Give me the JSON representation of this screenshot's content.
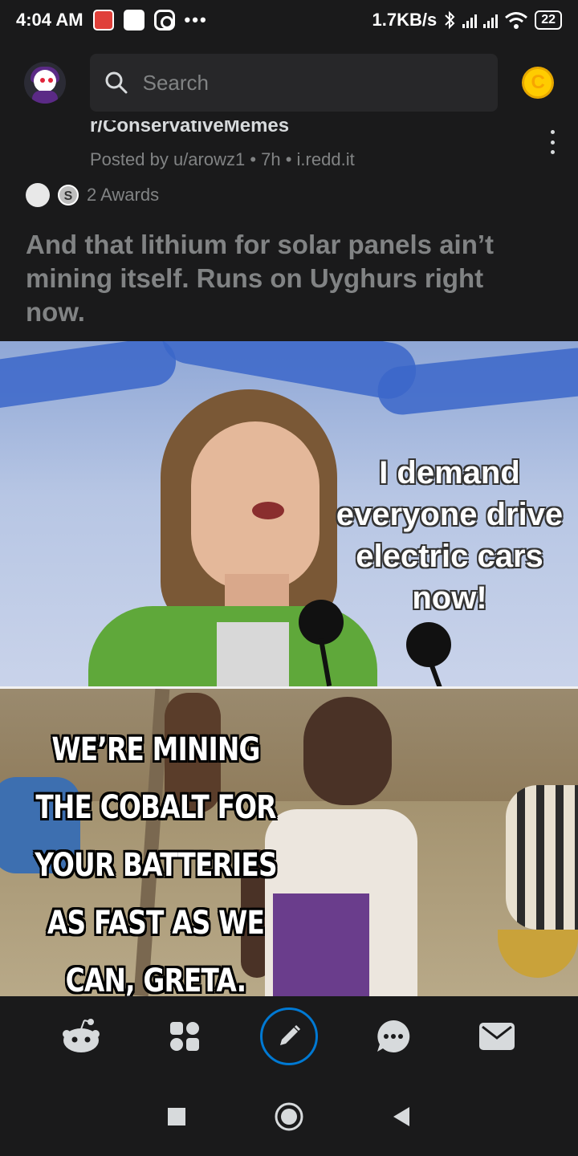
{
  "status_bar": {
    "time": "4:04 AM",
    "dots": "•••",
    "net_speed": "1.7KB/s",
    "battery": "22"
  },
  "search": {
    "placeholder": "Search"
  },
  "post": {
    "subreddit": "r/ConservativeMemes",
    "byline": "Posted by u/arowz1 • 7h • i.redd.it",
    "awards_label": "2 Awards",
    "title": "And that lithium for solar panels ain’t mining itself. Runs on Uyghurs right now.",
    "meme_top_text": "I demand everyone drive electric cars now!",
    "meme_bottom_lines": [
      "WE’RE MINING",
      "THE COBALT FOR",
      "YOUR BATTERIES",
      "AS FAST AS WE",
      "CAN, GRETA."
    ]
  },
  "icons": {
    "status": [
      "app-notification-icon",
      "webtoon-icon",
      "instagram-icon",
      "bluetooth-icon",
      "signal-icon",
      "wifi-icon",
      "battery-icon"
    ],
    "top_bar": [
      "avatar-icon",
      "search-icon",
      "coin-icon"
    ],
    "post": [
      "overflow-menu-icon",
      "award-icon"
    ],
    "bottom_nav": [
      "home-reddit-icon",
      "communities-icon",
      "create-post-icon",
      "chat-icon",
      "inbox-icon"
    ],
    "system_nav": [
      "recents-icon",
      "home-icon",
      "back-icon"
    ]
  },
  "colors": {
    "background": "#1a1a1b",
    "search_bg": "#272729",
    "muted_text": "#818384",
    "primary_text": "#d7dadc",
    "accent_blue": "#0079d3",
    "coin": "#ffcc00"
  }
}
